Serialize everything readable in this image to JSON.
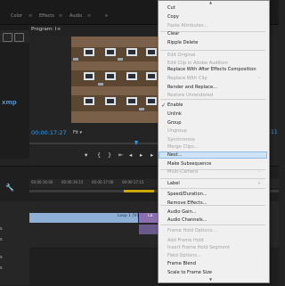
{
  "tabs": {
    "items": [
      {
        "label": "Color"
      },
      {
        "label": "Effects"
      },
      {
        "label": "Audio"
      }
    ],
    "more": "»"
  },
  "left_panel": {
    "label": "xmp"
  },
  "program_monitor": {
    "title": "Program: I",
    "timecode": "00:00:17:27",
    "fit": "Fit",
    "duration": ":11"
  },
  "timeline": {
    "ruler": [
      "00:00:16:00",
      "00:00:16:15",
      "00:00:17:00",
      "00:00:17:15"
    ],
    "track_letters": [
      "s",
      "s",
      "s",
      "s"
    ],
    "clips": [
      {
        "label": "Loop 1 [V]"
      },
      {
        "label": "La"
      }
    ]
  },
  "context_menu": {
    "items": [
      {
        "label": "Cut",
        "enabled": true
      },
      {
        "label": "Copy",
        "enabled": true
      },
      {
        "label": "Paste Attributes...",
        "enabled": false
      },
      {
        "label": "Clear",
        "enabled": true
      },
      {
        "label": "Ripple Delete",
        "enabled": true
      },
      {
        "label": "Edit Original",
        "enabled": false
      },
      {
        "label": "Edit Clip in Adobe Audition",
        "enabled": false
      },
      {
        "label": "Replace With After Effects Composition",
        "enabled": true
      },
      {
        "label": "Replace With Clip",
        "enabled": false,
        "submenu": true
      },
      {
        "label": "Render and Replace...",
        "enabled": true
      },
      {
        "label": "Restore Unrendered",
        "enabled": false
      },
      {
        "label": "Enable",
        "enabled": true,
        "checked": true
      },
      {
        "label": "Unlink",
        "enabled": true
      },
      {
        "label": "Group",
        "enabled": true
      },
      {
        "label": "Ungroup",
        "enabled": false
      },
      {
        "label": "Synchronize",
        "enabled": false
      },
      {
        "label": "Merge Clips...",
        "enabled": false
      },
      {
        "label": "Nest...",
        "enabled": true,
        "highlighted": true
      },
      {
        "label": "Make Subsequence",
        "enabled": true
      },
      {
        "label": "Multi-Camera",
        "enabled": false,
        "submenu": true
      },
      {
        "label": "Label",
        "enabled": true,
        "submenu": true
      },
      {
        "label": "Speed/Duration...",
        "enabled": true
      },
      {
        "label": "Remove Effects...",
        "enabled": true
      },
      {
        "label": "Audio Gain...",
        "enabled": true
      },
      {
        "label": "Audio Channels...",
        "enabled": true
      },
      {
        "label": "Frame Hold Options...",
        "enabled": false
      },
      {
        "label": "Add Frame Hold",
        "enabled": false
      },
      {
        "label": "Insert Frame Hold Segment",
        "enabled": false
      },
      {
        "label": "Field Options...",
        "enabled": false
      },
      {
        "label": "Frame Blend",
        "enabled": true
      },
      {
        "label": "Scale to Frame Size",
        "enabled": true
      }
    ],
    "check_glyph": "✓",
    "submenu_glyph": "›",
    "scroll_up": "▲",
    "scroll_down": "▼"
  },
  "colors": {
    "timecode": "#2f9ef0",
    "menu_highlight": "#cfe3f6",
    "clip_video": "#8fb0d6",
    "clip_purple": "#8c6fb0"
  }
}
